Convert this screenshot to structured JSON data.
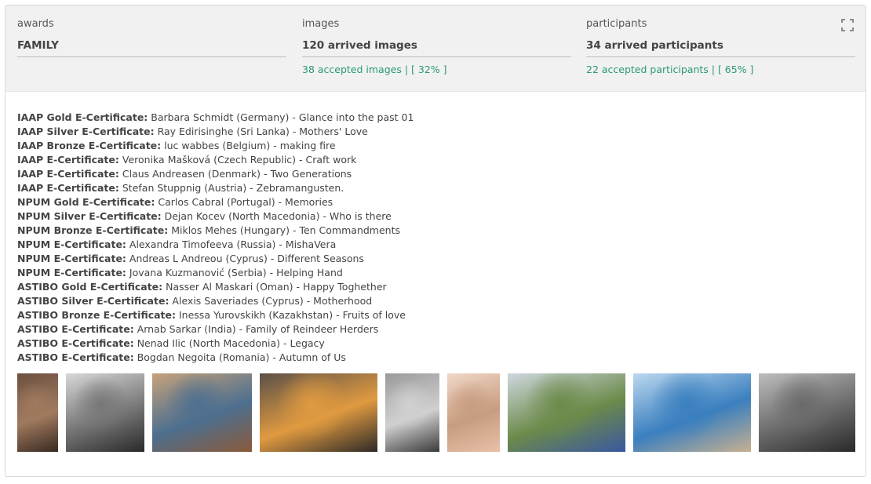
{
  "stats": {
    "awards": {
      "label": "awards",
      "value": "FAMILY"
    },
    "images": {
      "label": "images",
      "value": "120 arrived images",
      "sub": "38 accepted images | [ 32% ]"
    },
    "participants": {
      "label": "participants",
      "value": "34 arrived participants",
      "sub": "22 accepted participants | [ 65% ]"
    }
  },
  "expand_icon": "fullscreen-expand-icon",
  "awards_list": [
    {
      "title": "IAAP Gold E-Certificate:",
      "text": " Barbara Schmidt (Germany) - Glance into the past 01"
    },
    {
      "title": "IAAP Silver E-Certificate:",
      "text": " Ray Edirisinghe (Sri Lanka) - Mothers' Love"
    },
    {
      "title": "IAAP Bronze E-Certificate:",
      "text": " luc wabbes (Belgium) - making fire"
    },
    {
      "title": "IAAP E-Certificate:",
      "text": " Veronika Mašková (Czech Republic) - Craft work"
    },
    {
      "title": "IAAP E-Certificate:",
      "text": " Claus Andreasen (Denmark) - Two Generations"
    },
    {
      "title": "IAAP E-Certificate:",
      "text": " Stefan Stuppnig (Austria) - Zebramangusten."
    },
    {
      "title": "NPUM Gold E-Certificate:",
      "text": " Carlos Cabral (Portugal) - Memories"
    },
    {
      "title": "NPUM Silver E-Certificate:",
      "text": " Dejan Kocev (North Macedonia) - Who is there"
    },
    {
      "title": "NPUM Bronze E-Certificate:",
      "text": " Miklos Mehes (Hungary) - Ten Commandments"
    },
    {
      "title": "NPUM E-Certificate:",
      "text": " Alexandra Timofeeva (Russia) - MishaVera"
    },
    {
      "title": "NPUM E-Certificate:",
      "text": " Andreas L Andreou (Cyprus) - Different Seasons"
    },
    {
      "title": "NPUM E-Certificate:",
      "text": " Jovana Kuzmanović (Serbia) - Helping Hand"
    },
    {
      "title": "ASTIBO Gold E-Certificate:",
      "text": " Nasser Al Maskari (Oman) - Happy Toghether"
    },
    {
      "title": "ASTIBO Silver E-Certificate:",
      "text": " Alexis Saveriades (Cyprus) - Motherhood"
    },
    {
      "title": "ASTIBO Bronze E-Certificate:",
      "text": " Inessa Yurovskikh (Kazakhstan) - Fruits of love"
    },
    {
      "title": "ASTIBO E-Certificate:",
      "text": " Arnab Sarkar (India) - Family of Reindeer Herders"
    },
    {
      "title": "ASTIBO E-Certificate:",
      "text": " Nenad Ilic (North Macedonia) - Legacy"
    },
    {
      "title": "ASTIBO E-Certificate:",
      "text": " Bogdan Negoita (Romania) - Autumn of Us"
    }
  ],
  "thumbnails": [
    {
      "name": "thumb-mother-child",
      "colors": [
        "#6b5040",
        "#a07a5e",
        "#3a2a22"
      ]
    },
    {
      "name": "thumb-elderly-couple-portrait",
      "colors": [
        "#d8d8d8",
        "#777777",
        "#2a2a2a"
      ]
    },
    {
      "name": "thumb-craft-work",
      "colors": [
        "#c7a27a",
        "#4d6f8f",
        "#8a5a3a"
      ]
    },
    {
      "name": "thumb-making-fire",
      "colors": [
        "#5a5048",
        "#e09a40",
        "#2e2a28"
      ]
    },
    {
      "name": "thumb-mother-baby-bw",
      "colors": [
        "#9a9a9a",
        "#d0d0d0",
        "#3a3a3a"
      ]
    },
    {
      "name": "thumb-motherhood-closeup",
      "colors": [
        "#f0d8c8",
        "#c89c80",
        "#e8c0a8"
      ]
    },
    {
      "name": "thumb-reindeer-herders",
      "colors": [
        "#cfd8df",
        "#6c8a4a",
        "#3a58a0"
      ]
    },
    {
      "name": "thumb-seaside-bench",
      "colors": [
        "#bcd8ef",
        "#3a7fbf",
        "#c8b090"
      ]
    },
    {
      "name": "thumb-autumn-forest-bw",
      "colors": [
        "#bdbdbd",
        "#6a6a6a",
        "#2a2a2a"
      ]
    }
  ]
}
